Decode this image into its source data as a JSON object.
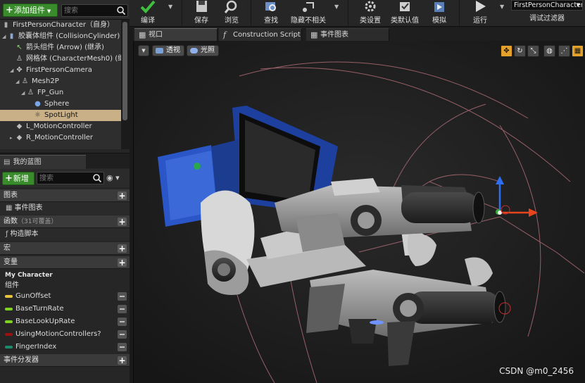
{
  "components": {
    "add_button": "添加组件",
    "search_placeholder": "搜索",
    "tree": [
      {
        "label": "FirstPersonCharacter（自身）",
        "icon": "capsule-icon",
        "selected": false
      },
      {
        "label": "胶囊体组件 (CollisionCylinder) (继",
        "icon": "capsule-icon",
        "selected": false
      },
      {
        "label": "箭头组件 (Arrow) (继承)",
        "icon": "arrow-icon",
        "selected": false
      },
      {
        "label": "网格体 (CharacterMesh0) (继承",
        "icon": "mesh-icon",
        "selected": false
      },
      {
        "label": "FirstPersonCamera",
        "icon": "camera-icon",
        "selected": false
      },
      {
        "label": "Mesh2P",
        "icon": "mesh-icon",
        "selected": false
      },
      {
        "label": "FP_Gun",
        "icon": "mesh-icon",
        "selected": false
      },
      {
        "label": "Sphere",
        "icon": "sphere-icon",
        "selected": false
      },
      {
        "label": "SpotLight",
        "icon": "spotlight-icon",
        "selected": true
      },
      {
        "label": "L_MotionController",
        "icon": "motion-controller-icon",
        "selected": false
      },
      {
        "label": "R_MotionController",
        "icon": "motion-controller-icon",
        "selected": false
      }
    ]
  },
  "my_blueprint": {
    "tab_label": "我的蓝图",
    "add_button": "新增",
    "search_placeholder": "搜索",
    "sections": {
      "graphs": "图表",
      "event_graph": "事件图表",
      "functions": "函数",
      "functions_count": "（31可覆盖）",
      "construction_script": "构造脚本",
      "macros": "宏",
      "variables": "变量",
      "my_character": "My Character",
      "components": "组件",
      "event_dispatchers": "事件分发器"
    },
    "variables": [
      {
        "name": "GunOffset",
        "color": "#e8c33a"
      },
      {
        "name": "BaseTurnRate",
        "color": "#7ed321"
      },
      {
        "name": "BaseLookUpRate",
        "color": "#7ed321"
      },
      {
        "name": "UsingMotionControllers?",
        "color": "#9c1010"
      },
      {
        "name": "FingerIndex",
        "color": "#1b8a6b"
      }
    ]
  },
  "toolbar": {
    "compile": "编译",
    "save": "保存",
    "browse": "浏览",
    "find": "查找",
    "hide_unrelated": "隐藏不相关",
    "class_settings": "类设置",
    "class_defaults": "类默认值",
    "simulate": "模拟",
    "run": "运行",
    "debug_object": "FirstPersonCharacter",
    "debug_filter": "调试过滤器"
  },
  "tabs": [
    {
      "label": "视口",
      "icon": "viewport-icon",
      "active": true
    },
    {
      "label": "Construction Script",
      "icon": "function-icon",
      "active": false
    },
    {
      "label": "事件图表",
      "icon": "graph-icon",
      "active": false
    }
  ],
  "viewport": {
    "perspective": "透视",
    "lit": "光照"
  },
  "watermark": "CSDN @m0_2456"
}
